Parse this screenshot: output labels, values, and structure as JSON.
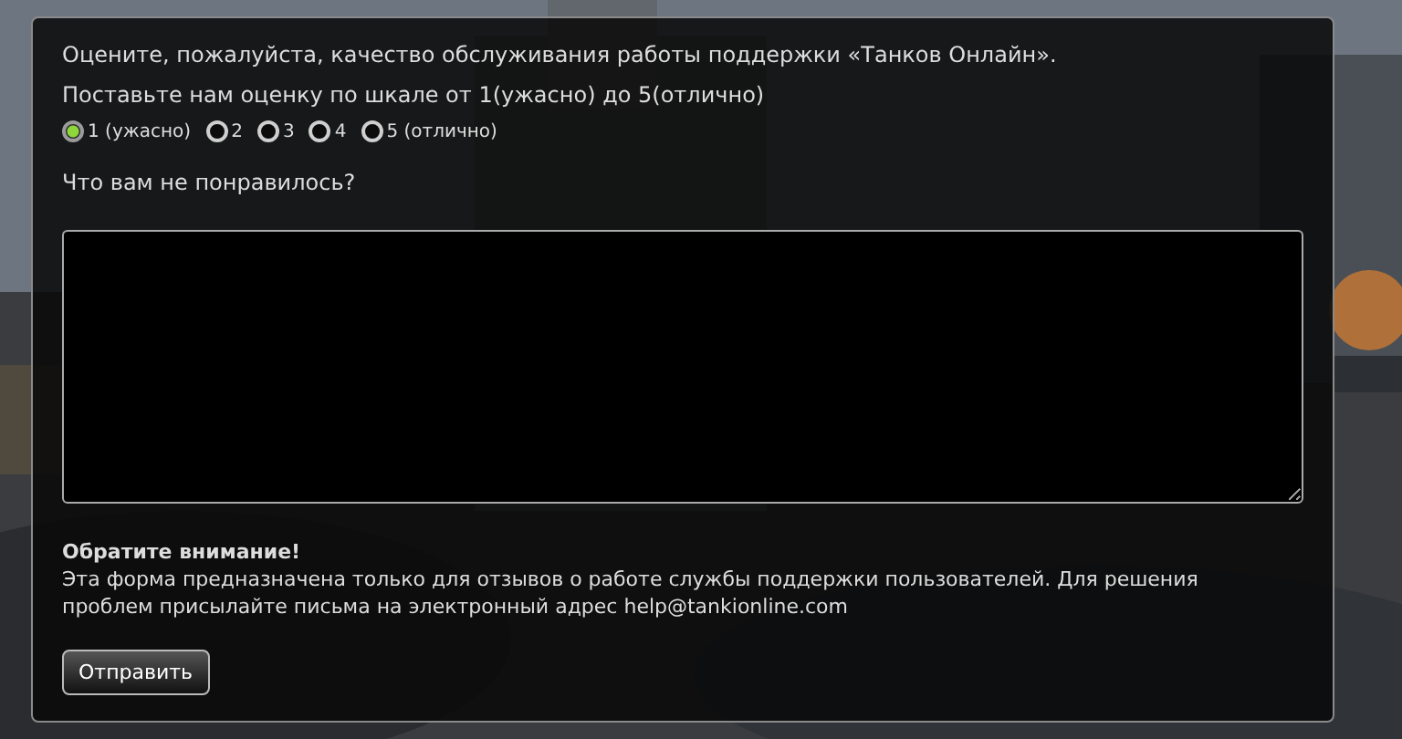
{
  "intro": "Оцените, пожалуйста, качество обслуживания работы поддержки «Танков Онлайн».",
  "scale_prompt": "Поставьте нам оценку по шкале от 1(ужасно) до 5(отлично)",
  "ratings": [
    {
      "label": "1 (ужасно)",
      "selected": true
    },
    {
      "label": "2",
      "selected": false
    },
    {
      "label": "3",
      "selected": false
    },
    {
      "label": "4",
      "selected": false
    },
    {
      "label": "5 (отлично)",
      "selected": false
    }
  ],
  "question": "Что вам не понравилось?",
  "notice": {
    "title": "Обратите внимание!",
    "text": "Эта форма предназначена только для отзывов о работе службы поддержки пользователей. Для решения проблем присылайте письма на электронный адрес help@tankionline.com"
  },
  "submit_button": "Отправить"
}
